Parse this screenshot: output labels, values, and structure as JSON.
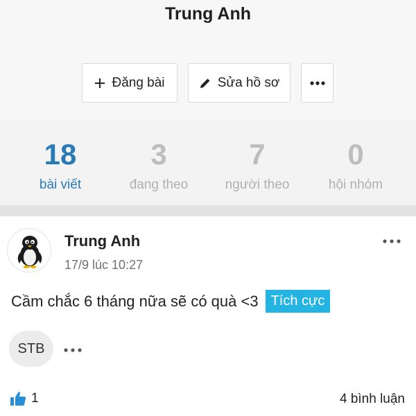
{
  "profile": {
    "name": "Trung Anh",
    "actions": {
      "post_label": "Đăng bài",
      "edit_label": "Sửa hồ sơ"
    }
  },
  "stats": [
    {
      "value": "18",
      "label": "bài viết",
      "active": true
    },
    {
      "value": "3",
      "label": "đang theo",
      "active": false
    },
    {
      "value": "7",
      "label": "người theo",
      "active": false
    },
    {
      "value": "0",
      "label": "hội nhóm",
      "active": false
    }
  ],
  "post": {
    "author": "Trung Anh",
    "timestamp": "17/9 lúc 10:27",
    "text": "Cầm chắc 6 tháng nữa sẽ có quà <3",
    "sentiment_tag": "Tích cực",
    "stock_chip": "STB",
    "like_count": "1",
    "comment_count": "4 bình luận"
  },
  "colors": {
    "accent": "#2a7ab6",
    "tag_bg": "#23b4e2",
    "like_icon": "#2a8fd6"
  },
  "icons": [
    "plus-icon",
    "pencil-icon",
    "more-dots-icon",
    "penguin-avatar",
    "thumbs-up-icon"
  ]
}
